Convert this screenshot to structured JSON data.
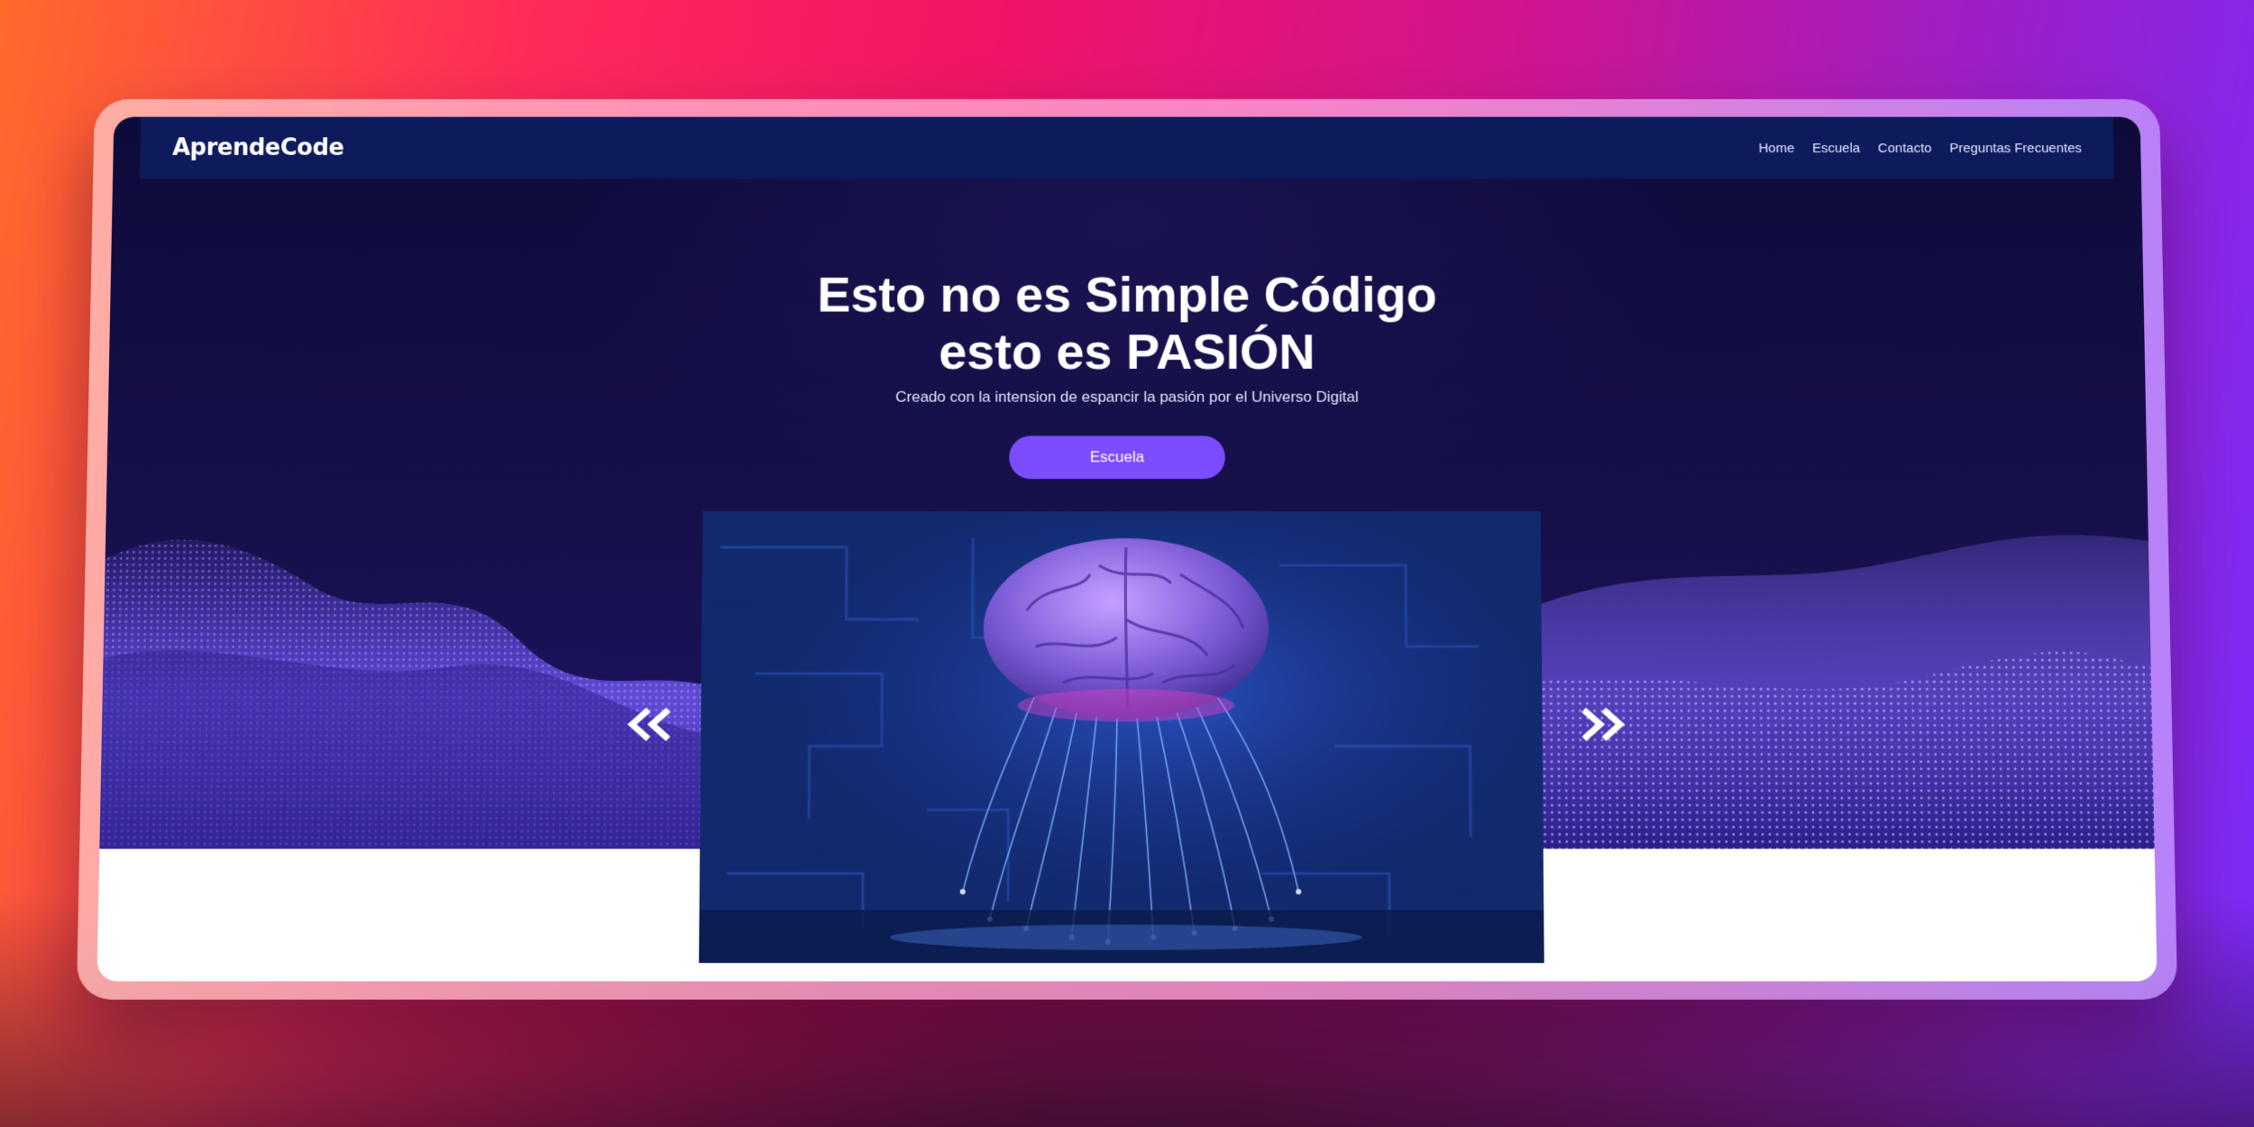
{
  "header": {
    "brand": "AprendeCode",
    "nav": [
      {
        "label": "Home"
      },
      {
        "label": "Escuela"
      },
      {
        "label": "Contacto"
      },
      {
        "label": "Preguntas Frecuentes"
      }
    ]
  },
  "hero": {
    "title_line1": "Esto no es Simple Código",
    "title_line2": "esto es PASIÓN",
    "subtitle": "Creado con la intension de espancir la pasión por el Universo Digital",
    "button_label": "Escuela"
  },
  "carousel": {
    "image_icon": "brain-icon",
    "prev_icon": "chevron-double-left-icon",
    "next_icon": "chevron-double-right-icon"
  },
  "colors": {
    "navbar": "#0d1a5c",
    "hero_background": "#16104a",
    "button": "#7b4dff",
    "wave_particles": "#7a5cff"
  }
}
